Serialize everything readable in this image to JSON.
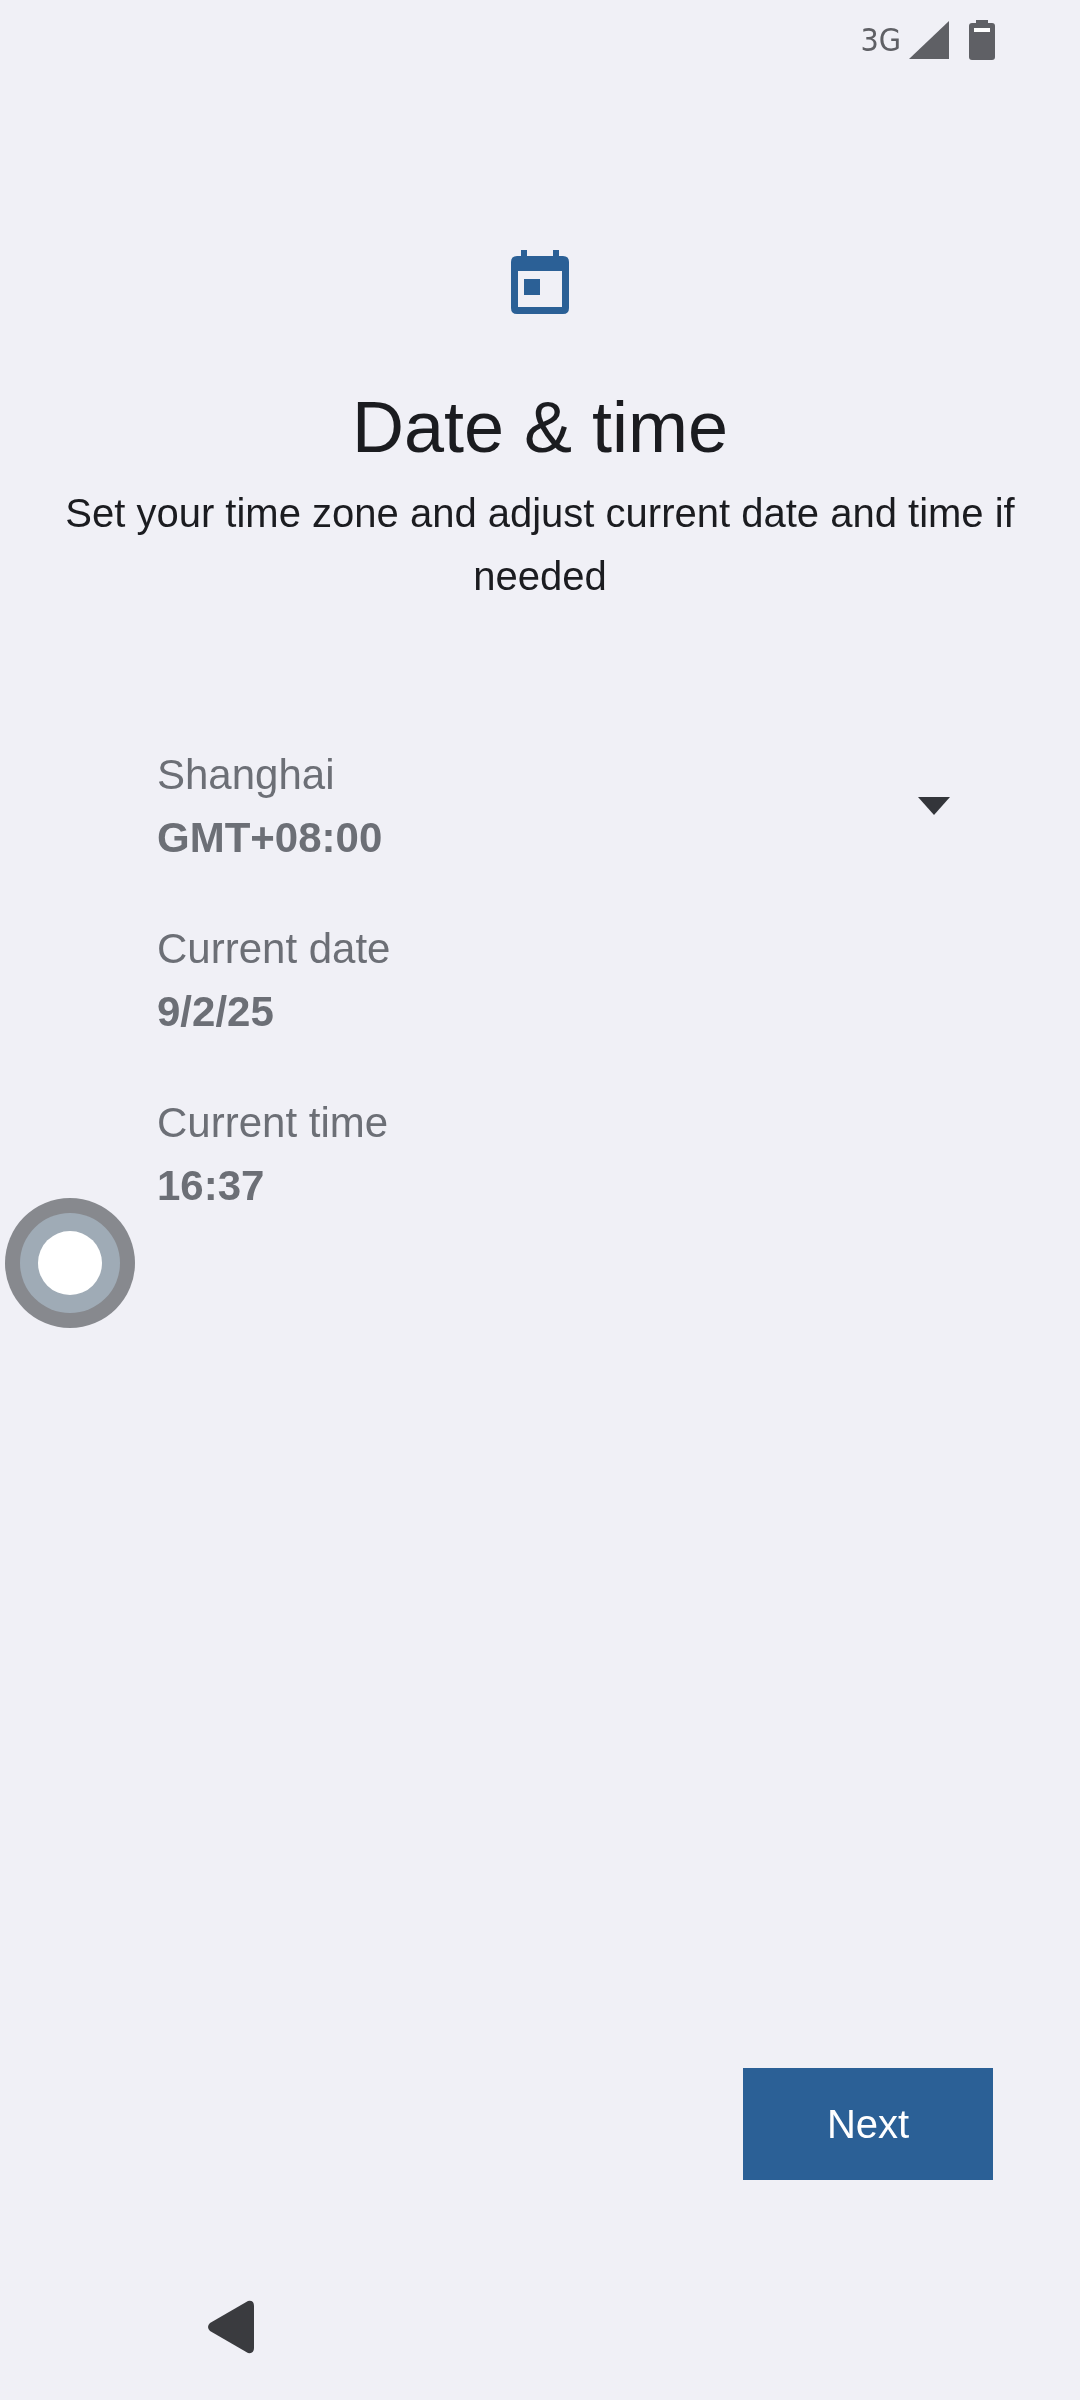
{
  "status_bar": {
    "network": "3G"
  },
  "header": {
    "title": "Date & time",
    "subtitle": "Set your time zone and adjust current date and time if needed"
  },
  "settings": [
    {
      "kind": "dropdown",
      "label": "Shanghai",
      "value": "GMT+08:00"
    },
    {
      "kind": "plain",
      "label": "Current date",
      "value": "9/2/25"
    },
    {
      "kind": "plain",
      "label": "Current time",
      "value": "16:37"
    }
  ],
  "buttons": {
    "next": "Next"
  }
}
